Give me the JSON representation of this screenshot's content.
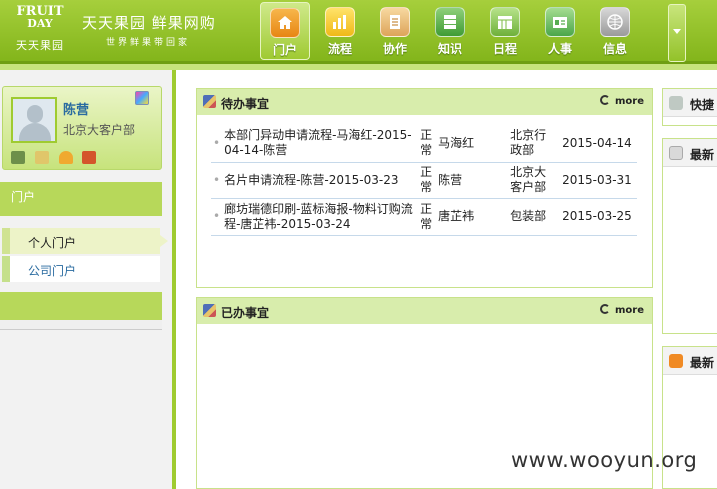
{
  "brand": {
    "logo_top": "FRUIT",
    "logo_bottom": "DAY",
    "logo_cn": "天天果园",
    "title": "天天果园  鲜果网购",
    "slogan": "世界鲜果带回家"
  },
  "nav": {
    "items": [
      {
        "label": "门户",
        "icon": "home-icon",
        "active": true
      },
      {
        "label": "流程",
        "icon": "bar-chart-icon"
      },
      {
        "label": "协作",
        "icon": "document-icon"
      },
      {
        "label": "知识",
        "icon": "database-icon"
      },
      {
        "label": "日程",
        "icon": "calendar-icon"
      },
      {
        "label": "人事",
        "icon": "id-card-icon"
      },
      {
        "label": "信息",
        "icon": "globe-icon"
      }
    ],
    "more_icon": "dropdown-arrow-icon"
  },
  "profile": {
    "name": "陈营",
    "department": "北京大客户部"
  },
  "sidebar": {
    "section_label": "门户",
    "items": [
      {
        "label": "个人门户",
        "active": true
      },
      {
        "label": "公司门户"
      }
    ]
  },
  "todo": {
    "title": "待办事宜",
    "more": "more",
    "rows": [
      {
        "title": "本部门异动申请流程-马海红-2015-04-14-陈营",
        "status": "正常",
        "user": "马海红",
        "dept": "北京行政部",
        "date": "2015-04-14"
      },
      {
        "title": "名片申请流程-陈营-2015-03-23",
        "status": "正常",
        "user": "陈营",
        "dept": "北京大客户部",
        "date": "2015-03-31"
      },
      {
        "title": "廊坊瑞德印刷-蓝标海报-物料订购流程-唐芷袆-2015-03-24",
        "status": "正常",
        "user": "唐芷袆",
        "dept": "包装部",
        "date": "2015-03-25"
      }
    ]
  },
  "done": {
    "title": "已办事宜",
    "more": "more"
  },
  "right": {
    "panel1": "快捷",
    "panel2": "最新",
    "panel3": "最新"
  },
  "watermark": "www.wooyun.org"
}
